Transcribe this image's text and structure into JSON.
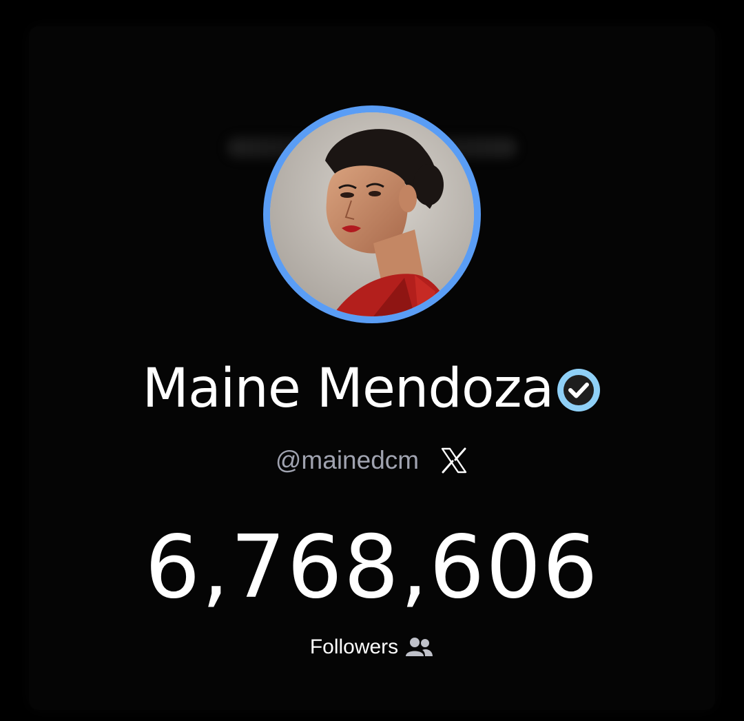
{
  "profile": {
    "name": "Maine Mendoza",
    "handle": "@mainedcm",
    "platform_icon": "x-logo-icon",
    "verified_icon": "verified-badge-icon",
    "follower_count": "6,768,606",
    "followers_label": "Followers",
    "followers_icon": "users-icon"
  },
  "colors": {
    "background": "#000000",
    "avatar_ring": "#5a9df5",
    "verified_badge": "#8fd0f7",
    "handle_text": "#a0a3b0",
    "primary_text": "#ffffff"
  }
}
